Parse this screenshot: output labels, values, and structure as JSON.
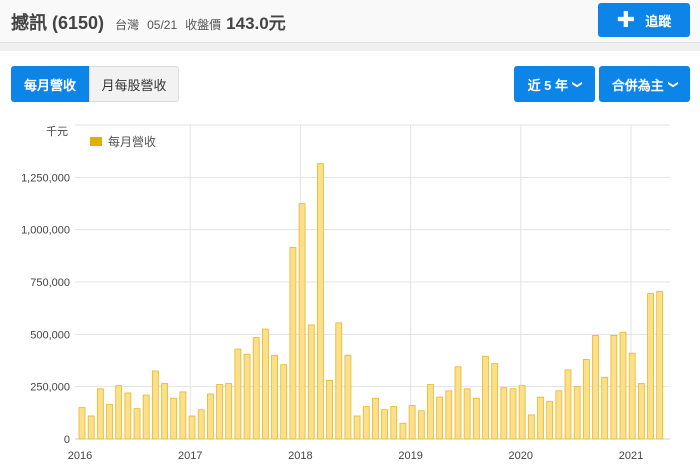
{
  "header": {
    "stock_name": "撼訊",
    "stock_code": "(6150)",
    "market": "台灣",
    "date": "05/21",
    "close_label": "收盤價",
    "price": "143.0元",
    "follow_label": "追蹤"
  },
  "tabs": [
    {
      "label": "每月營收",
      "active": true
    },
    {
      "label": "月每股營收",
      "active": false
    }
  ],
  "dropdowns": {
    "period": "近 5 年",
    "basis": "合併為主"
  },
  "colors": {
    "accent": "#0d84e8",
    "bar_fill": "#fbdf8a",
    "bar_stroke": "#e8b824",
    "legend": "#e0b000"
  },
  "chart_data": {
    "type": "bar",
    "title": "",
    "unit_label": "千元",
    "legend": [
      {
        "name": "每月營收",
        "placement": "top-left"
      }
    ],
    "ylim": [
      0,
      1500000
    ],
    "yticks": [
      0,
      250000,
      500000,
      750000,
      1000000,
      1250000
    ],
    "ytick_labels": [
      "0",
      "250,000",
      "500,000",
      "750,000",
      "1,000,000",
      "1,250,000"
    ],
    "xtick_labels": [
      "2016",
      "2017",
      "2018",
      "2019",
      "2020",
      "2021"
    ],
    "start": "2016-01",
    "values": [
      150000,
      110000,
      240000,
      165000,
      255000,
      220000,
      145000,
      210000,
      325000,
      265000,
      195000,
      225000,
      110000,
      140000,
      215000,
      260000,
      265000,
      430000,
      405000,
      485000,
      525000,
      400000,
      355000,
      915000,
      1125000,
      545000,
      1315000,
      280000,
      555000,
      400000,
      110000,
      155000,
      195000,
      140000,
      155000,
      75000,
      160000,
      135000,
      260000,
      200000,
      230000,
      345000,
      240000,
      195000,
      395000,
      360000,
      245000,
      240000,
      255000,
      115000,
      200000,
      180000,
      230000,
      330000,
      250000,
      380000,
      495000,
      295000,
      495000,
      510000,
      410000,
      265000,
      695000,
      705000
    ]
  }
}
